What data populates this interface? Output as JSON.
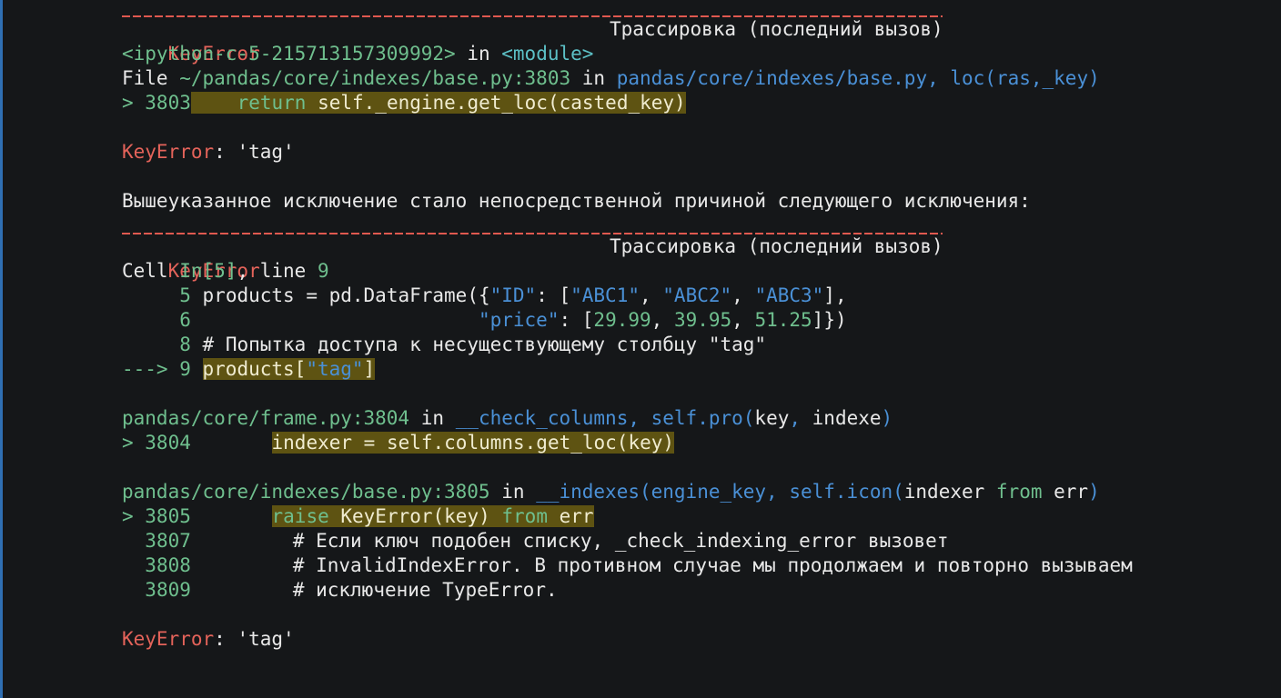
{
  "tb1": {
    "exc_name": "KeyError",
    "heading": "Трассировка (последний вызов)",
    "frame1_loc": "<ipython-c-5-215713157309992>",
    "in": "in",
    "module": "<module>",
    "file_label": "File",
    "file_path": "~/pandas/core/indexes/base.py:3803",
    "file_func": "pandas/core/indexes/base.py, loc(ras,_key)",
    "arrow_line": "> 3803",
    "code_kw": "return",
    "code_rest": "self._engine.get_loc(casted_key)",
    "error_name": "KeyError",
    "error_msg": ": 'tag'"
  },
  "middle_message": "Вышеуказанное исключение стало непосредственной причиной следующего исключения:",
  "tb2": {
    "exc_name": "KeyError",
    "heading": "Трассировка (последний вызов)",
    "cell_label": "Cell",
    "cell_in": "In[5]",
    "cell_line": ", line",
    "cell_line_no": "9",
    "lines": [
      {
        "no": "5",
        "text": "products = pd.DataFrame({",
        "s1": "\"ID\"",
        "t2": ": [",
        "s2": "\"ABC1\"",
        "t3": ", ",
        "s3": "\"ABC2\"",
        "t4": ", ",
        "s4": "\"ABC3\"",
        "t5": "],"
      },
      {
        "no": "6",
        "pad": "                        ",
        "s1": "\"price\"",
        "t2": ": [",
        "n1": "29.99",
        "t3": ", ",
        "n2": "39.95",
        "t4": ", ",
        "n3": "51.25",
        "t5": "]})"
      },
      {
        "no": "8",
        "text": "# Попытка доступа к несуществующему столбцу \"tag\""
      }
    ],
    "arrow": "---> 9",
    "arrow_code_a": "products[",
    "arrow_code_s": "\"tag\"",
    "arrow_code_b": "]",
    "frame2_path": "pandas/core/frame.py:3804",
    "frame2_in": "in",
    "frame2_func": "__check_columns, self.pro(",
    "frame2_func_b": "key",
    "frame2_func_c": ", ",
    "frame2_func_d": "indexe",
    "frame2_func_e": ")",
    "frame2_arrow": "> 3804",
    "frame2_code": "indexer = self.columns.get_loc(key)",
    "frame3_path": "pandas/core/indexes/base.py:3805",
    "frame3_in": "in",
    "frame3_func": "__indexes(engine_key, self.icon(",
    "frame3_func_b": "indexer",
    "frame3_func_c": " from ",
    "frame3_func_d": "err",
    "frame3_func_e": ")",
    "frame3_arrow": "> 3805",
    "frame3_kw": "raise",
    "frame3_code": " KeyError(key) ",
    "frame3_from": "from",
    "frame3_err": " err",
    "context": [
      {
        "no": "3807",
        "text": "# Если ключ подобен списку, _check_indexing_error вызовет"
      },
      {
        "no": "3808",
        "text": "# InvalidIndexError. В противном случае мы продолжаем и повторно вызываем"
      },
      {
        "no": "3809",
        "text": "# исключение TypeError."
      }
    ],
    "error_name": "KeyError",
    "error_msg": ": 'tag'"
  }
}
